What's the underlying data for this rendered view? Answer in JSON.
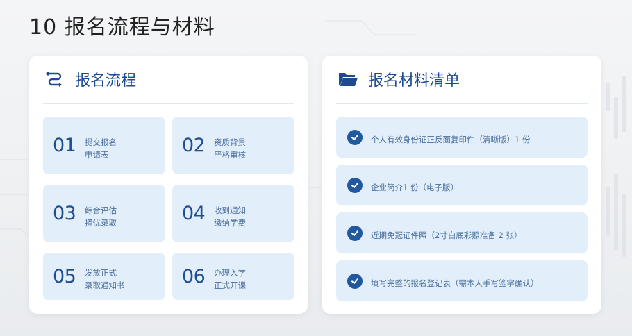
{
  "page": {
    "title": "10 报名流程与材料"
  },
  "process": {
    "heading": "报名流程",
    "icon": "flow-route-icon",
    "steps": [
      {
        "num": "01",
        "line1": "提交报名",
        "line2": "申请表"
      },
      {
        "num": "02",
        "line1": "资质背景",
        "line2": "严格审核"
      },
      {
        "num": "03",
        "line1": "综合评估",
        "line2": "择优录取"
      },
      {
        "num": "04",
        "line1": "收到通知",
        "line2": "缴纳学费"
      },
      {
        "num": "05",
        "line1": "发放正式",
        "line2": "录取通知书"
      },
      {
        "num": "06",
        "line1": "办理入学",
        "line2": "正式开课"
      }
    ]
  },
  "materials": {
    "heading": "报名材料清单",
    "icon": "folder-open-icon",
    "items": [
      {
        "text": "个人有效身份证正反面复印件（清晰版）1 份"
      },
      {
        "text": "企业简介1 份（电子版）"
      },
      {
        "text": "近期免冠证件照（2寸白底彩照准备 2 张）"
      },
      {
        "text": "填写完整的报名登记表（需本人手写签字确认）"
      }
    ]
  },
  "colors": {
    "accent": "#1e4b8f",
    "tile": "#e2eefa",
    "check": "#21599f",
    "muted_text": "#4a6f9c"
  }
}
